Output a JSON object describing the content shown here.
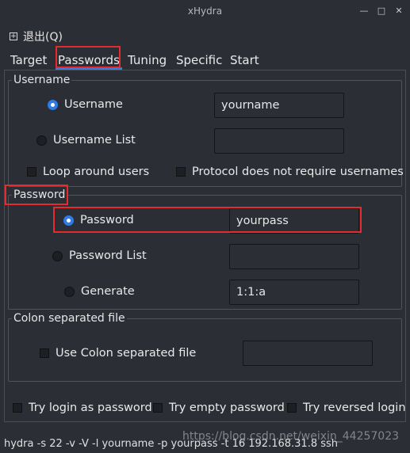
{
  "window": {
    "title": "xHydra",
    "controls": {
      "minimize": "—",
      "maximize": "□",
      "close": "✕"
    }
  },
  "menu": {
    "quit_label": "退出(Q)"
  },
  "tabs": [
    {
      "label": "Target"
    },
    {
      "label": "Passwords",
      "active": true
    },
    {
      "label": "Tuning"
    },
    {
      "label": "Specific"
    },
    {
      "label": "Start"
    }
  ],
  "username_group": {
    "title": "Username",
    "username_option": {
      "label": "Username",
      "selected": true,
      "value": "yourname"
    },
    "username_list_option": {
      "label": "Username List",
      "selected": false,
      "value": ""
    },
    "loop_around_users": {
      "label": "Loop around users",
      "checked": false
    },
    "no_usernames": {
      "label": "Protocol does not require usernames",
      "checked": false
    }
  },
  "password_group": {
    "title": "Password",
    "password_option": {
      "label": "Password",
      "selected": true,
      "value": "yourpass"
    },
    "password_list_option": {
      "label": "Password List",
      "selected": false,
      "value": ""
    },
    "generate_option": {
      "label": "Generate",
      "selected": false,
      "value": "1:1:a"
    }
  },
  "colon_group": {
    "title": "Colon separated file",
    "use_colon": {
      "label": "Use Colon separated file",
      "checked": false,
      "value": ""
    }
  },
  "options": {
    "login_as_password": {
      "label": "Try login as password",
      "checked": false
    },
    "empty_password": {
      "label": "Try empty password",
      "checked": false
    },
    "reversed_login": {
      "label": "Try reversed login",
      "checked": false
    }
  },
  "command_line": "hydra -s 22 -v -V -l yourname -p yourpass -t 16 192.168.31.8 ssh",
  "watermark": "https://blog.csdn.net/weixin_44257023",
  "colors": {
    "accent": "#2f7ce6",
    "highlight": "#e52b2b",
    "background": "#2b2e35"
  }
}
